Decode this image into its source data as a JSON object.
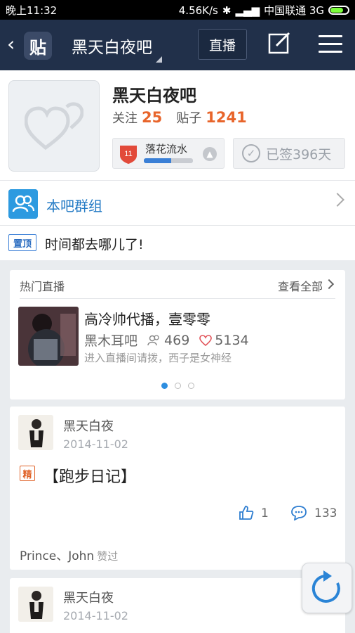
{
  "status_bar": {
    "time": "晚上11:32",
    "speed": "4.56K/s",
    "carrier": "中国联通 3G"
  },
  "header": {
    "logo_text": "贴",
    "title": "黑天白夜吧",
    "live_button": "直播"
  },
  "forum": {
    "name": "黑天白夜吧",
    "follow_label": "关注",
    "follow_count": "25",
    "posts_label": "贴子",
    "posts_count": "1241",
    "level": {
      "number": "11",
      "name": "落花流水",
      "progress": 0.55
    },
    "signed_text": "已签396天"
  },
  "group": {
    "label": "本吧群组"
  },
  "pinned": {
    "badge": "置顶",
    "text": "时间都去哪儿了!"
  },
  "live": {
    "heading": "热门直播",
    "view_all": "查看全部",
    "title": "高冷帅代播，壹零零",
    "bar_name": "黑木耳吧",
    "viewers": "469",
    "likes": "5134",
    "desc": "进入直播间请拨，西子是女神经",
    "page_index": 0,
    "page_count": 3
  },
  "posts": [
    {
      "user": "黑天白夜",
      "date": "2014-11-02",
      "badge": "精",
      "title": "【跑步日记】",
      "likes": "1",
      "replies": "133",
      "likers": "Prince、John",
      "likers_suffix": "赞过"
    },
    {
      "user": "黑天白夜",
      "date": "2014-11-02"
    }
  ],
  "colors": {
    "accent": "#2d8ee0",
    "header_bg": "#21304a",
    "number_orange": "#e8652b"
  }
}
